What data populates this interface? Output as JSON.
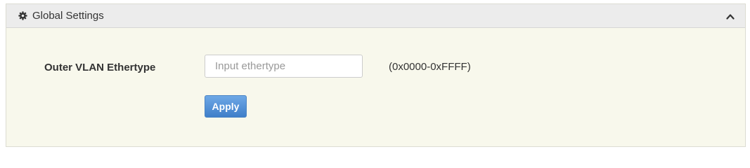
{
  "panel": {
    "header": {
      "icon": "gear-icon",
      "title": "Global Settings",
      "collapse_icon": "chevron-up-icon"
    },
    "form": {
      "outer_vlan_ethertype": {
        "label": "Outer VLAN Ethertype",
        "value": "",
        "placeholder": "Input ethertype",
        "range_hint": "(0x0000-0xFFFF)"
      },
      "apply_label": "Apply"
    }
  },
  "colors": {
    "panel_background": "#f8f8ec",
    "header_background": "#ececec",
    "button_blue": "#4a8ad6"
  }
}
